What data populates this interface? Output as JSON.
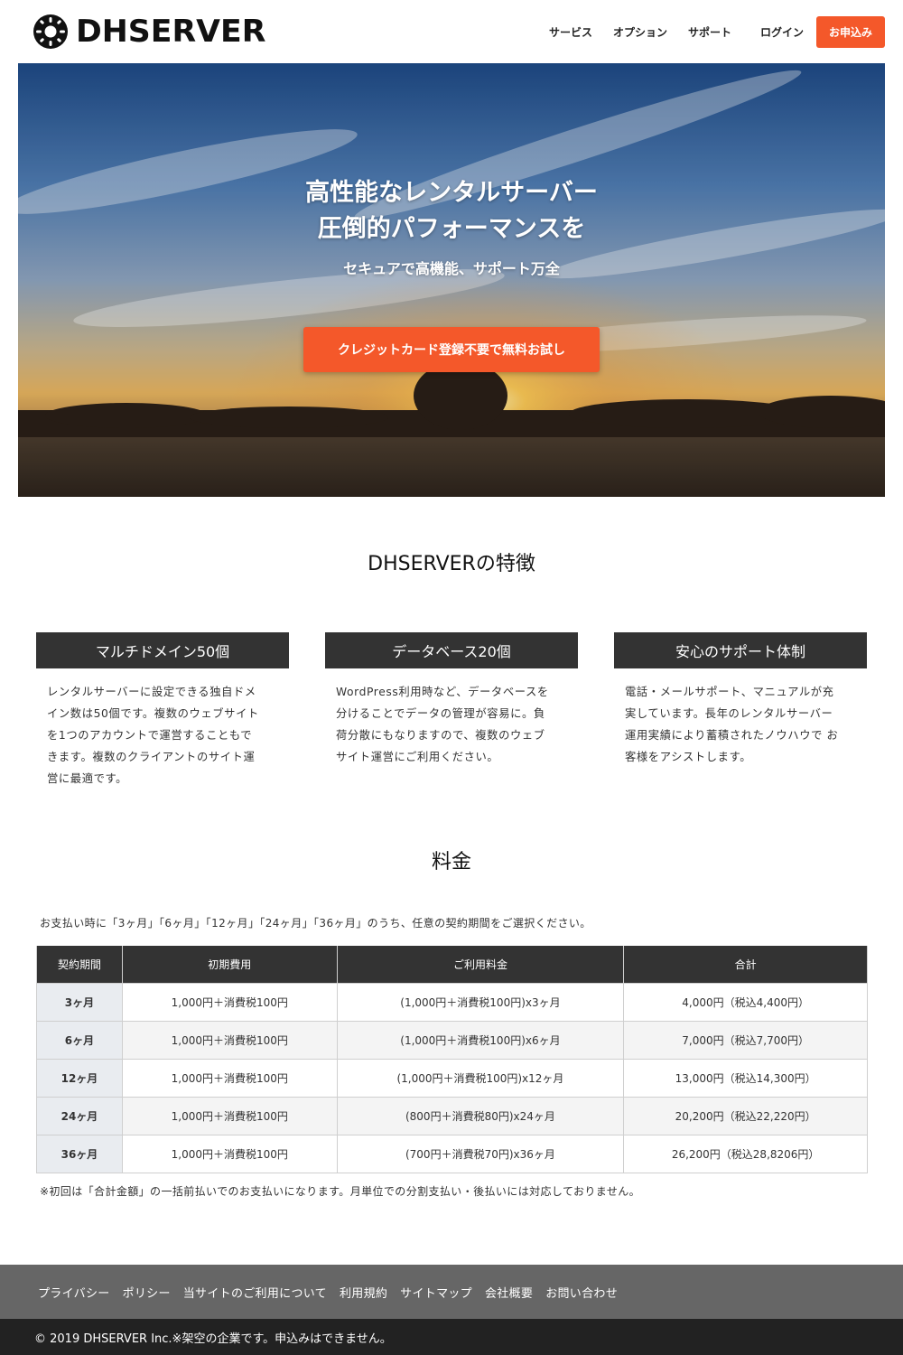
{
  "header": {
    "logo_text": "DHSERVER",
    "nav": [
      "サービス",
      "オプション",
      "サポート"
    ],
    "login_label": "ログイン",
    "cta_label": "お申込み"
  },
  "hero": {
    "title_line1": "高性能なレンタルサーバー",
    "title_line2": "圧倒的パフォーマンスを",
    "subtitle": "セキュアで高機能、サポート万全",
    "button_label": "クレジットカード登録不要で無料お試し"
  },
  "features": {
    "title": "DHSERVERの特徴",
    "items": [
      {
        "heading": "マルチドメイン50個",
        "lines": [
          "レンタルサーバーに設定できる独自ドメ",
          "イン数は50個です。複数のウェブサイト",
          "を1つのアカウントで運営することもで",
          "きます。複数のクライアントのサイト運",
          "営に最適です。"
        ]
      },
      {
        "heading": "データベース20個",
        "lines": [
          "WordPress利用時など、データベースを",
          "分けることでデータの管理が容易に。負",
          "荷分散にもなりますので、複数のウェブ",
          "サイト運営にご利用ください。"
        ]
      },
      {
        "heading": "安心のサポート体制",
        "lines": [
          "電話・メールサポート、マニュアルが充",
          "実しています。長年のレンタルサーバー",
          "運用実績により蓄積されたノウハウで お",
          "客様をアシストします。"
        ]
      }
    ]
  },
  "pricing": {
    "title": "料金",
    "note": "お支払い時に「3ヶ月」「6ヶ月」「12ヶ月」「24ヶ月」「36ヶ月」のうち、任意の契約期間をご選択ください。",
    "headers": [
      "契約期間",
      "初期費用",
      "ご利用料金",
      "合計"
    ],
    "rows": [
      [
        "3ヶ月",
        "1,000円＋消費税100円",
        "(1,000円＋消費税100円)x3ヶ月",
        "4,000円（税込4,400円）"
      ],
      [
        "6ヶ月",
        "1,000円＋消費税100円",
        "(1,000円＋消費税100円)x6ヶ月",
        "7,000円（税込7,700円）"
      ],
      [
        "12ヶ月",
        "1,000円＋消費税100円",
        "(1,000円＋消費税100円)x12ヶ月",
        "13,000円（税込14,300円）"
      ],
      [
        "24ヶ月",
        "1,000円＋消費税100円",
        "(800円＋消費税80円)x24ヶ月",
        "20,200円（税込22,220円）"
      ],
      [
        "36ヶ月",
        "1,000円＋消費税100円",
        "(700円＋消費税70円)x36ヶ月",
        "26,200円（税込28,8206円）"
      ]
    ],
    "footnote": "※初回は「合計金額」の一括前払いでのお支払いになります。月単位での分割支払い・後払いには対応しておりません。"
  },
  "footer": {
    "links": [
      "プライバシー",
      "ポリシー",
      "当サイトのご利用について",
      "利用規約",
      "サイトマップ",
      "会社概要",
      "お問い合わせ"
    ],
    "copyright": "© 2019 DHSERVER Inc.※架空の企業です。申込みはできません。"
  },
  "colors": {
    "accent": "#f4582a",
    "dark": "#333333",
    "footer_bg": "#666666",
    "copyright_bg": "#222222"
  }
}
